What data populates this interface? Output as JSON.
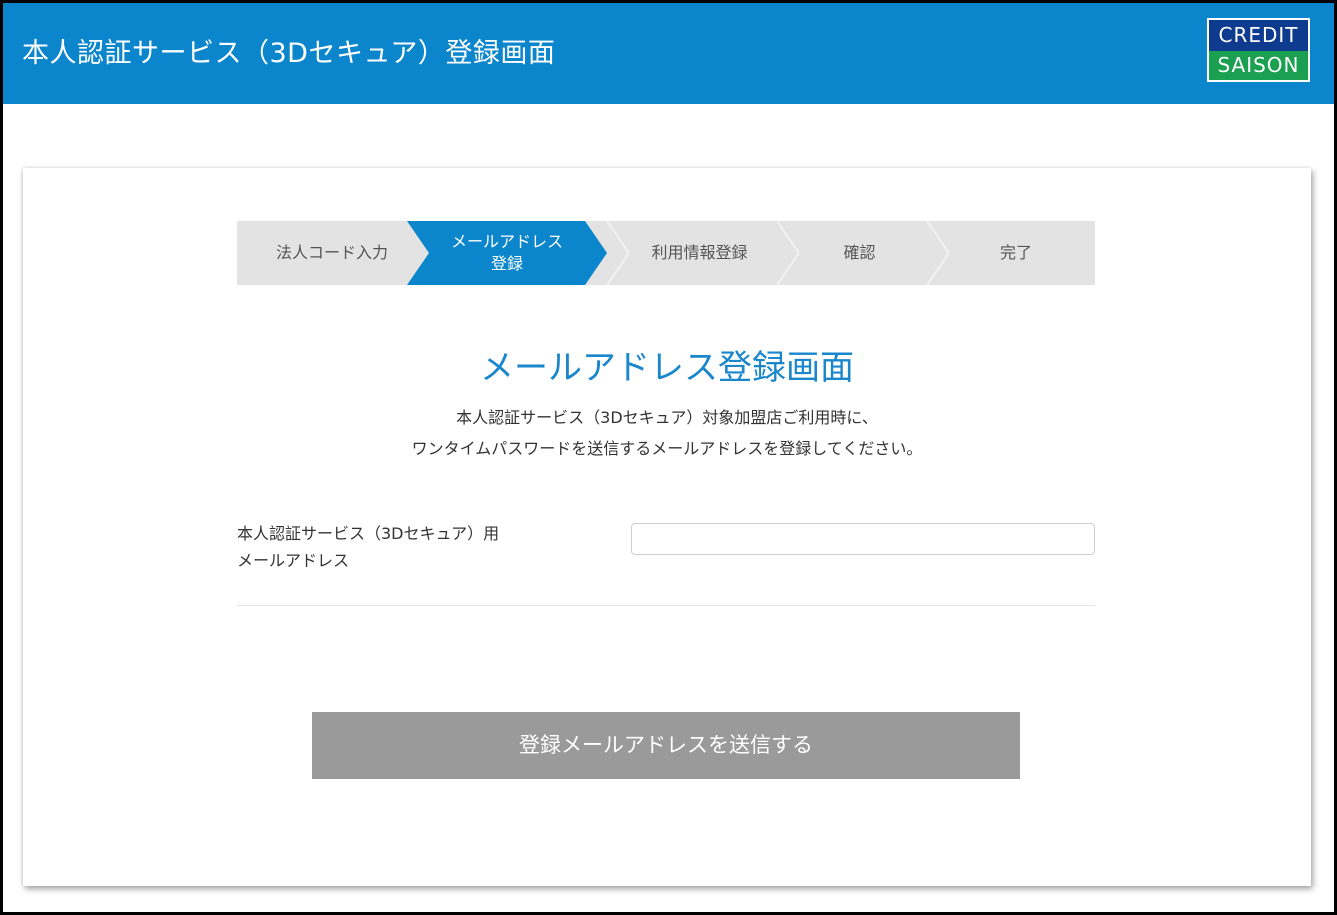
{
  "header": {
    "title": "本人認証サービス（3Dセキュア）登録画面",
    "logo_top": "CREDIT",
    "logo_bottom": "SAISON"
  },
  "steps": [
    {
      "label": "法人コード入力",
      "active": false
    },
    {
      "label_line1": "メールアドレス",
      "label_line2": "登録",
      "active": true
    },
    {
      "label": "利用情報登録",
      "active": false
    },
    {
      "label": "確認",
      "active": false
    },
    {
      "label": "完了",
      "active": false
    }
  ],
  "main": {
    "heading": "メールアドレス登録画面",
    "desc_line1": "本人認証サービス（3Dセキュア）対象加盟店ご利用時に、",
    "desc_line2": "ワンタイムパスワードを送信するメールアドレスを登録してください。",
    "field_label_line1": "本人認証サービス（3Dセキュア）用",
    "field_label_line2": "メールアドレス",
    "email_value": "",
    "submit_label": "登録メールアドレスを送信する"
  },
  "colors": {
    "header_bg": "#0b86cc",
    "active_step": "#0b86cc",
    "heading": "#1a86cc",
    "logo_blue": "#0f3b8f",
    "logo_green": "#1aa050",
    "button_disabled": "#9a9a9a"
  }
}
